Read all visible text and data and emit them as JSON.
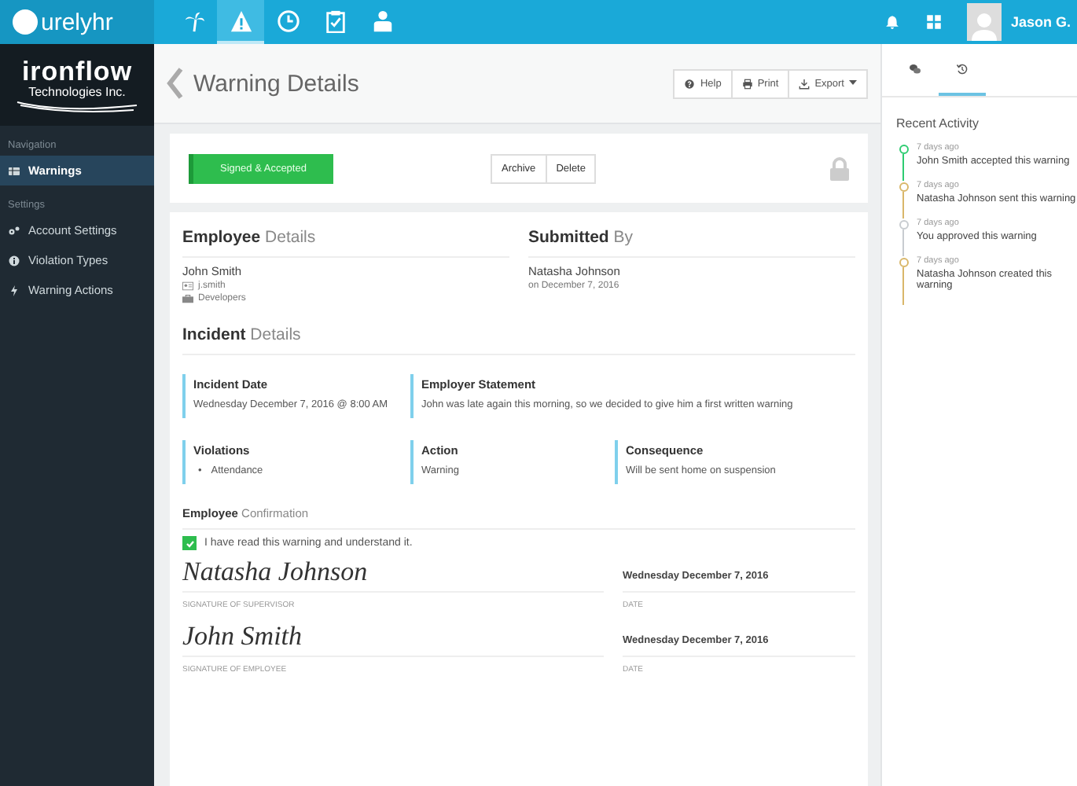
{
  "topbar": {
    "logo": "urelyhr",
    "nav": [
      {
        "kind": "palm",
        "selected": false
      },
      {
        "kind": "warning",
        "selected": true
      },
      {
        "kind": "clock",
        "selected": false
      },
      {
        "kind": "clipboard",
        "selected": false
      },
      {
        "kind": "person",
        "selected": false
      }
    ],
    "user": "Jason G."
  },
  "sidebar": {
    "brand": "ironflow",
    "brand_sub": "Technologies Inc.",
    "sections": [
      {
        "heading": "Navigation",
        "items": [
          {
            "label": "Warnings",
            "kind": "grid",
            "selected": true
          }
        ]
      },
      {
        "heading": "Settings",
        "items": [
          {
            "label": "Account Settings",
            "kind": "gears",
            "selected": false
          },
          {
            "label": "Violation Types",
            "kind": "info",
            "selected": false
          },
          {
            "label": "Warning Actions",
            "kind": "bolt",
            "selected": false
          }
        ]
      }
    ]
  },
  "header": {
    "title": "Warning Details",
    "buttons": [
      {
        "label": "Help",
        "kind": "help"
      },
      {
        "label": "Print",
        "kind": "print"
      },
      {
        "label": "Export",
        "kind": "download"
      }
    ]
  },
  "status_card": {
    "status": "Signed & Accepted",
    "actions": [
      "Archive",
      "Delete"
    ],
    "locked": true
  },
  "employee": {
    "heading": "**Employee** Details",
    "name": "John Smith",
    "username": "j.smith",
    "department": "Developers"
  },
  "submitted": {
    "heading": "**Submitted** By",
    "name": "Natasha Johnson",
    "date": "on December 7, 2016"
  },
  "incident": {
    "heading": "**Incident** Details",
    "fields": [
      {
        "label": "Incident Date",
        "value": "Wednesday December 7, 2016 @ 8:00 AM"
      },
      {
        "label": "Employer Statement",
        "value": "John was late again this morning, so we decided to give him a first written warning"
      },
      {
        "label": "Violations",
        "bullets": [
          {
            "marker": "•",
            "text": "Attendance"
          }
        ]
      },
      {
        "label": "Action",
        "value": "Warning"
      },
      {
        "label": "Consequence",
        "value": "Will be sent home on suspension"
      }
    ]
  },
  "confirmation": {
    "heading": "**Employee** Confirmation",
    "checkbox": {
      "label": "I have read this warning and understand it.",
      "checked": true
    },
    "signatures": [
      {
        "signature": "Natasha Johnson",
        "caption": "SIGNATURE OF SUPERVISOR",
        "date": "Wednesday December 7, 2016",
        "date_caption": "DATE"
      },
      {
        "signature": "John Smith",
        "caption": "SIGNATURE OF EMPLOYEE",
        "date": "Wednesday December 7, 2016",
        "date_caption": "DATE"
      }
    ]
  },
  "activity": {
    "tabs": [
      {
        "kind": "chat",
        "selected": false
      },
      {
        "kind": "history",
        "selected": true
      }
    ],
    "title": "Recent Activity",
    "items": [
      {
        "time": "7 days ago",
        "text": "John Smith accepted this warning",
        "color": "#2ecc71"
      },
      {
        "time": "7 days ago",
        "text": "Natasha Johnson sent this warning",
        "color": "#d9b76a"
      },
      {
        "time": "7 days ago",
        "text": "You approved this warning",
        "color": "#c8ccd0"
      },
      {
        "time": "7 days ago",
        "text": "Natasha Johnson created this warning",
        "color": "#d9b76a"
      }
    ]
  }
}
